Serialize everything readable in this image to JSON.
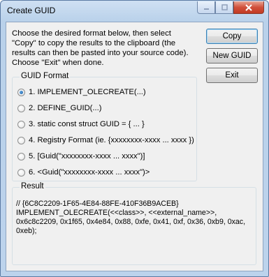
{
  "window": {
    "title": "Create GUID"
  },
  "caption_buttons": {
    "minimize_icon": "minimize-icon",
    "maximize_icon": "maximize-icon",
    "close_icon": "close-icon"
  },
  "instructions": "Choose the desired format below, then select \"Copy\" to copy the results to the clipboard (the results can then be pasted into your source code).  Choose \"Exit\" when done.",
  "buttons": {
    "copy": "Copy",
    "new_guid": "New GUID",
    "exit": "Exit"
  },
  "guid_format": {
    "label": "GUID Format",
    "selected_index": 0,
    "options": [
      "1. IMPLEMENT_OLECREATE(...)",
      "2. DEFINE_GUID(...)",
      "3. static const struct GUID = { ... }",
      "4. Registry Format (ie. {xxxxxxxx-xxxx ... xxxx })",
      "5. [Guid(\"xxxxxxxx-xxxx ... xxxx\")]",
      "6. <Guid(\"xxxxxxxx-xxxx ... xxxx\")>"
    ]
  },
  "result": {
    "label": "Result",
    "text": "// {6C8C2209-1F65-4E84-88FE-410F36B9ACEB}\nIMPLEMENT_OLECREATE(<<class>>, <<external_name>>,\n0x6c8c2209, 0x1f65, 0x4e84, 0x88, 0xfe, 0x41, 0xf, 0x36, 0xb9, 0xac,\n0xeb);"
  }
}
